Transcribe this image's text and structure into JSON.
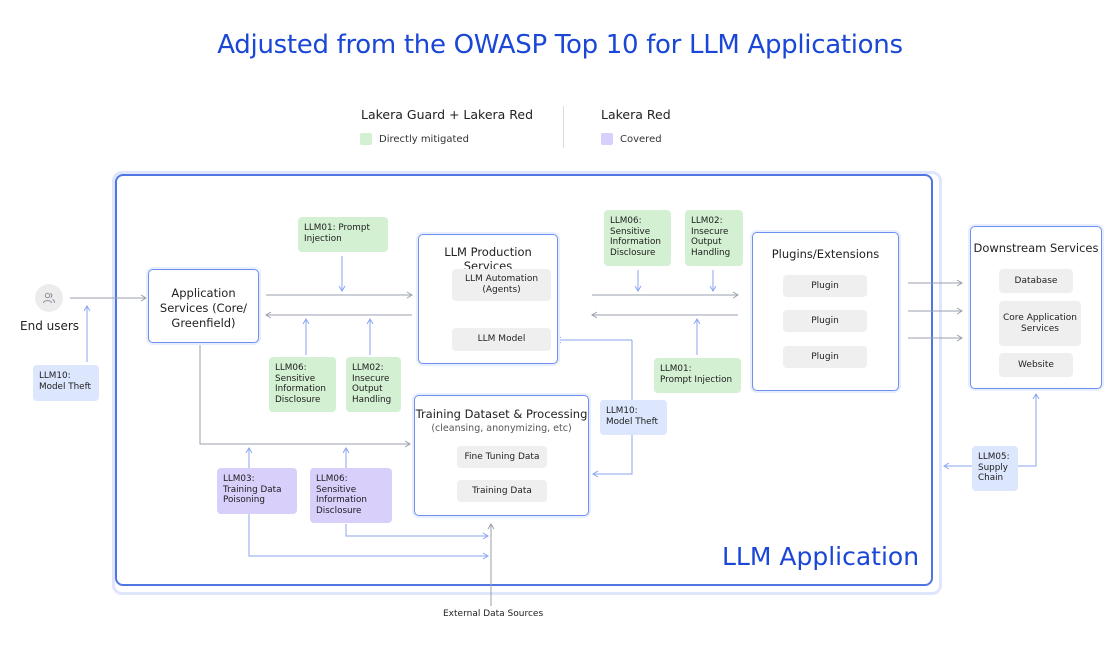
{
  "title": "Adjusted from the OWASP Top 10 for LLM Applications",
  "legend": {
    "groups": [
      {
        "heading": "Lakera Guard + Lakera Red",
        "item": "Directly mitigated",
        "color": "#d4f0d3"
      },
      {
        "heading": "Lakera Red",
        "item": "Covered",
        "color": "#d8cffb"
      }
    ]
  },
  "actors": {
    "end_users": {
      "label": "End users",
      "icon": "users-icon"
    },
    "external_sources": {
      "label": "External Data Sources"
    }
  },
  "app": {
    "label": "LLM Application",
    "application_services": {
      "title": "Application Services (Core/ Greenfield)"
    },
    "production_services": {
      "title": "LLM Production Services",
      "items": [
        "LLM Automation (Agents)",
        "LLM Model"
      ]
    },
    "training": {
      "title": "Training Dataset & Processing",
      "subtitle": "(cleansing, anonymizing, etc)",
      "items": [
        "Fine Tuning Data",
        "Training Data"
      ]
    },
    "plugins": {
      "title": "Plugins/Extensions",
      "items": [
        "Plugin",
        "Plugin",
        "Plugin"
      ]
    }
  },
  "downstream": {
    "title": "Downstream Services",
    "items": [
      "Database",
      "Core Application Services",
      "Website"
    ]
  },
  "risks": [
    {
      "id": "llm10-end",
      "text": "LLM10:\nModel Theft",
      "category": "blue"
    },
    {
      "id": "llm01-top",
      "text": "LLM01: Prompt\nInjection",
      "category": "green"
    },
    {
      "id": "llm06-left",
      "text": "LLM06:\nSensitive\nInformation\nDisclosure",
      "category": "green"
    },
    {
      "id": "llm02-left",
      "text": "LLM02:\nInsecure\nOutput\nHandling",
      "category": "green"
    },
    {
      "id": "llm06-right",
      "text": "LLM06:\nSensitive\nInformation\nDisclosure",
      "category": "green"
    },
    {
      "id": "llm02-right",
      "text": "LLM02:\nInsecure\nOutput\nHandling",
      "category": "green"
    },
    {
      "id": "llm01-right",
      "text": "LLM01:\nPrompt Injection",
      "category": "green"
    },
    {
      "id": "llm10-mid",
      "text": "LLM10:\nModel Theft",
      "category": "blue"
    },
    {
      "id": "llm03",
      "text": "LLM03:\nTraining Data\nPoisoning",
      "category": "purple"
    },
    {
      "id": "llm06-bottom",
      "text": "LLM06:\nSensitive\nInformation\nDisclosure",
      "category": "purple"
    },
    {
      "id": "llm05",
      "text": "LLM05:\nSupply\nChain",
      "category": "blue"
    }
  ]
}
